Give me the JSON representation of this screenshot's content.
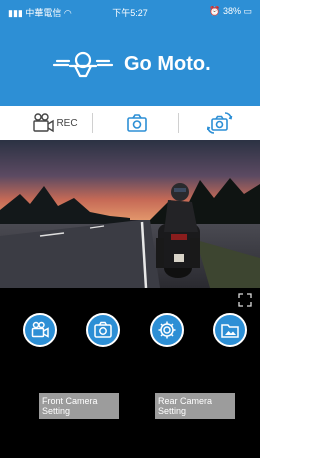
{
  "status_bar": {
    "carrier": "中華電信",
    "time": "下午5:27",
    "battery": "38%"
  },
  "header": {
    "brand_name": "Go Moto.",
    "brand_logo": "motorcycle-rider-icon"
  },
  "toolbar": {
    "rec_label": "REC",
    "snapshot_icon": "camera-icon",
    "switch_icon": "switch-camera-icon"
  },
  "controls": {
    "buttons": [
      {
        "icon": "video-camera-icon"
      },
      {
        "icon": "camera-icon"
      },
      {
        "icon": "gear-icon"
      },
      {
        "icon": "folder-image-icon"
      }
    ],
    "front_setting_label": "Front Camera Setting",
    "rear_setting_label": "Rear Camera Setting"
  },
  "colors": {
    "brand_blue": "#2d8fd5",
    "panel_black": "#000000",
    "setting_gray": "#9c9c9c"
  }
}
